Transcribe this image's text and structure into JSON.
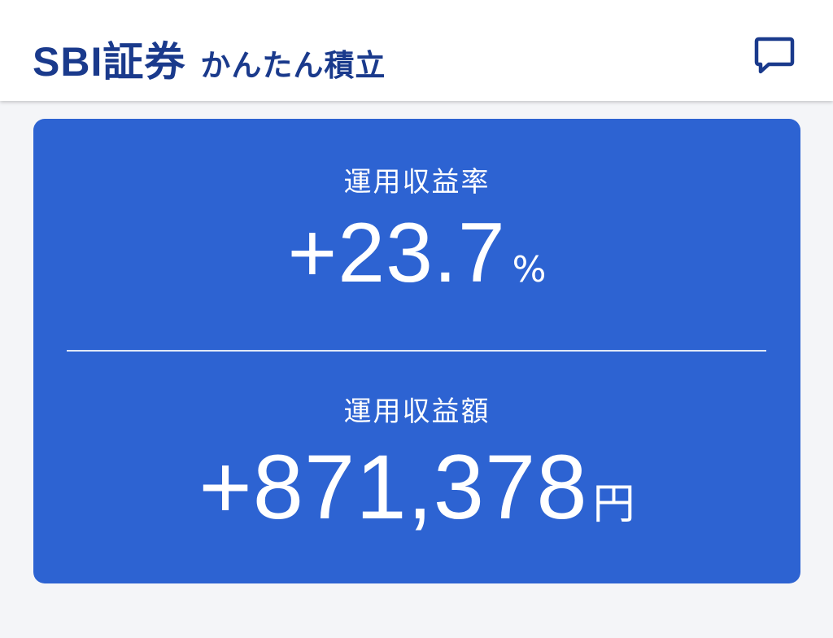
{
  "header": {
    "brand": "SBI証券",
    "subtitle": "かんたん積立",
    "chat_icon": "chat-bubble-icon"
  },
  "summary": {
    "return_rate": {
      "label": "運用収益率",
      "value": "+23.7",
      "unit": "%"
    },
    "return_amount": {
      "label": "運用収益額",
      "value": "+871,378",
      "unit": "円"
    }
  },
  "colors": {
    "brand": "#1a3a8c",
    "card": "#2d63d2",
    "background": "#f4f5f8",
    "text_on_card": "#ffffff"
  }
}
